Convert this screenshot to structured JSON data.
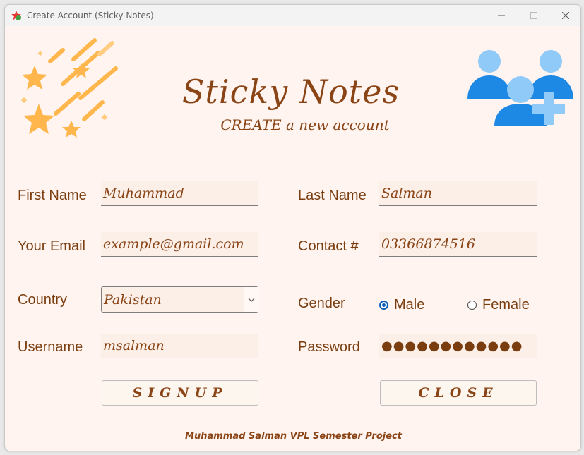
{
  "window": {
    "title": "Create Account (Sticky Notes)"
  },
  "header": {
    "title": "Sticky Notes",
    "subtitle": "CREATE a new account"
  },
  "form": {
    "first_name": {
      "label": "First Name",
      "value": "Muhammad"
    },
    "last_name": {
      "label": "Last Name",
      "value": "Salman"
    },
    "email": {
      "label": "Your Email",
      "value": "example@gmail.com"
    },
    "contact": {
      "label": "Contact #",
      "value": "03366874516"
    },
    "country": {
      "label": "Country",
      "value": "Pakistan"
    },
    "gender": {
      "label": "Gender",
      "options": [
        "Male",
        "Female"
      ],
      "selected": "Male"
    },
    "username": {
      "label": "Username",
      "value": "msalman"
    },
    "password": {
      "label": "Password",
      "masked": "●●●●●●●●●●●●"
    }
  },
  "buttons": {
    "signup": "SIGNUP",
    "close": "CLOSE"
  },
  "footer": "Muhammad Salman VPL Semester Project",
  "colors": {
    "background": "#fff4ef",
    "text_brown": "#8a4416",
    "field_bg": "#fbefe8",
    "icon_blue": "#1e88e5",
    "icon_light_blue": "#90caf9",
    "star_yellow": "#ffb74d"
  },
  "icons": {
    "app": "sticky-notes-app-icon",
    "decoration_left": "shooting-stars-icon",
    "decoration_right": "add-users-icon"
  }
}
